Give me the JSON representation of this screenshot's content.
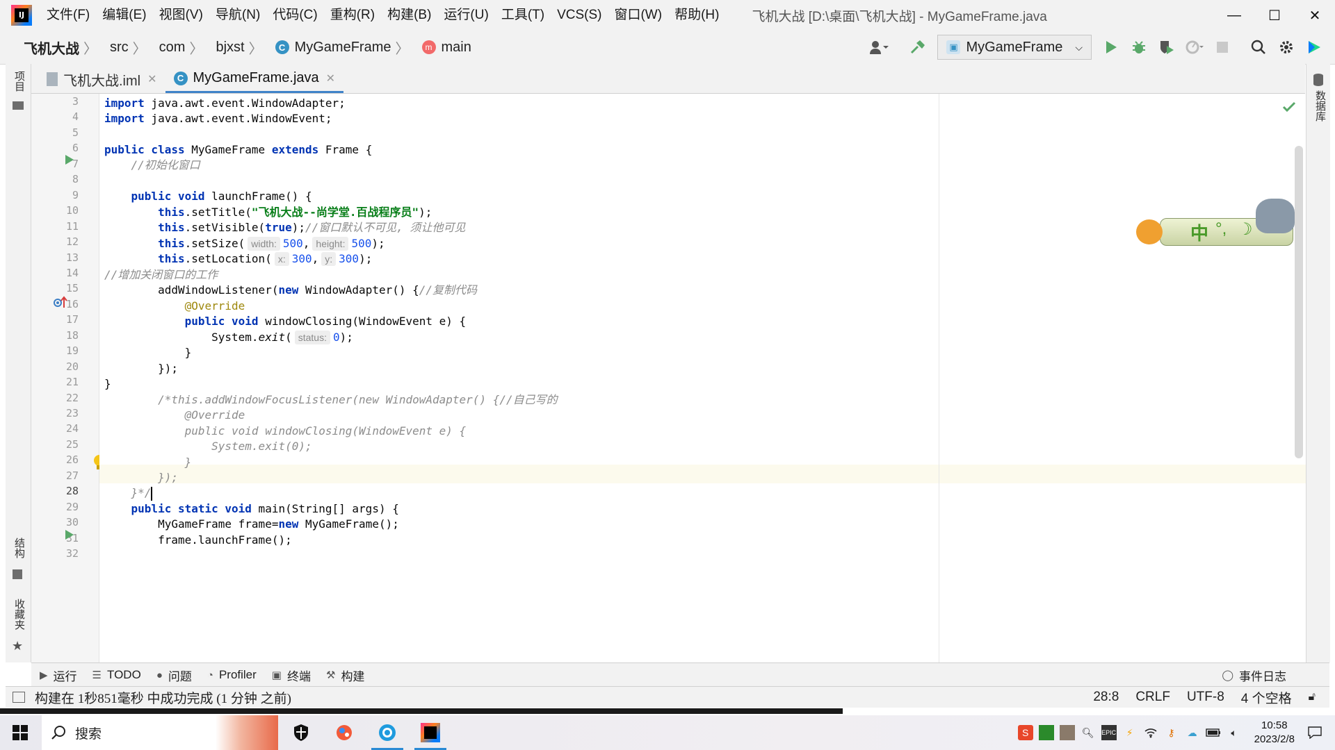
{
  "app": {
    "logo_text": "IJ",
    "menu": [
      "文件(F)",
      "编辑(E)",
      "视图(V)",
      "导航(N)",
      "代码(C)",
      "重构(R)",
      "构建(B)",
      "运行(U)",
      "工具(T)",
      "VCS(S)",
      "窗口(W)",
      "帮助(H)"
    ],
    "window_title": "飞机大战 [D:\\桌面\\飞机大战] - MyGameFrame.java",
    "window_controls": {
      "minimize": "—",
      "maximize": "☐",
      "close": "✕"
    }
  },
  "navbar": {
    "breadcrumbs": [
      "飞机大战",
      "src",
      "com",
      "bjxst",
      "MyGameFrame",
      "main"
    ],
    "run_config": "MyGameFrame"
  },
  "left_tools": [
    "项目",
    "结构",
    "收藏夹"
  ],
  "right_tools": [
    "数据库"
  ],
  "tabs": [
    {
      "label": "飞机大战.iml",
      "active": false
    },
    {
      "label": "MyGameFrame.java",
      "active": true
    }
  ],
  "editor": {
    "line_numbers": [
      "3",
      "4",
      "5",
      "6",
      "7",
      "8",
      "9",
      "10",
      "11",
      "12",
      "13",
      "14",
      "15",
      "16",
      "17",
      "18",
      "19",
      "20",
      "21",
      "22",
      "23",
      "24",
      "25",
      "26",
      "27",
      "28",
      "29",
      "30",
      "31",
      "32"
    ],
    "current_line": "28",
    "code": {
      "l3_kw": "import",
      "l3_rest": " java.awt.event.WindowAdapter;",
      "l4_kw": "import",
      "l4_rest": " java.awt.event.WindowEvent;",
      "l6_kw1": "public class",
      "l6_mid": " MyGameFrame ",
      "l6_kw2": "extends",
      "l6_rest": " Frame {",
      "l7_comment": "    //初始化窗口",
      "l9_indent": "    ",
      "l9_kw": "public void",
      "l9_rest": " launchFrame() {",
      "l10_kw": "        this",
      "l10_mid": ".setTitle(",
      "l10_str": "\"飞机大战--尚学堂.百战程序员\"",
      "l10_rest": ");",
      "l11_kw": "        this",
      "l11_mid": ".setVisible(",
      "l11_kw2": "true",
      "l11_rest": ");",
      "l11_comment": "//窗口默认不可见, 须让他可见",
      "l12_kw": "        this",
      "l12_mid": ".setSize(",
      "l12_hint1": "width:",
      "l12_v1": "500",
      "l12_sep": ",",
      "l12_hint2": "height:",
      "l12_v2": "500",
      "l12_rest": ");",
      "l13_kw": "        this",
      "l13_mid": ".setLocation(",
      "l13_hint1": "x:",
      "l13_v1": "300",
      "l13_sep": ",",
      "l13_hint2": "y:",
      "l13_v2": "300",
      "l13_rest": ");",
      "l14_comment": "//增加关闭窗口的工作",
      "l15_pre": "        addWindowListener(",
      "l15_kw": "new",
      "l15_rest": " WindowAdapter() {",
      "l15_comment": "//复制代码",
      "l16_anno": "            @Override",
      "l17_kw": "            public void",
      "l17_rest": " windowClosing(WindowEvent e) {",
      "l18_pre": "                System.",
      "l18_it": "exit",
      "l18_open": "(",
      "l18_hint": "status:",
      "l18_v": "0",
      "l18_rest": ");",
      "l19": "            }",
      "l20": "        });",
      "l21": "}",
      "l22_comment": "        /*this.addWindowFocusListener(new WindowAdapter() {//自己写的",
      "l23_comment": "            @Override",
      "l24_comment": "            public void windowClosing(WindowEvent e) {",
      "l25_comment": "                System.exit(0);",
      "l26_comment": "            }",
      "l27_comment": "        });",
      "l28_comment": "    }*/",
      "l29_indent": "    ",
      "l29_kw": "public static void",
      "l29_rest": " main(String[] args) {",
      "l30_pre": "        MyGameFrame frame=",
      "l30_kw": "new",
      "l30_rest": " MyGameFrame();",
      "l31": "        frame.launchFrame();"
    }
  },
  "ime_widget": {
    "label": "中",
    "punct": "°,",
    "moon": "☽"
  },
  "tool_tabs": [
    "运行",
    "TODO",
    "问题",
    "Profiler",
    "终端",
    "构建"
  ],
  "event_log": "事件日志",
  "status": {
    "message": "构建在 1秒851毫秒 中成功完成 (1 分钟 之前)",
    "position": "28:8",
    "line_sep": "CRLF",
    "encoding": "UTF-8",
    "indent": "4 个空格"
  },
  "taskbar": {
    "search_label": "搜索",
    "time": "10:58",
    "date": "2023/2/8"
  }
}
